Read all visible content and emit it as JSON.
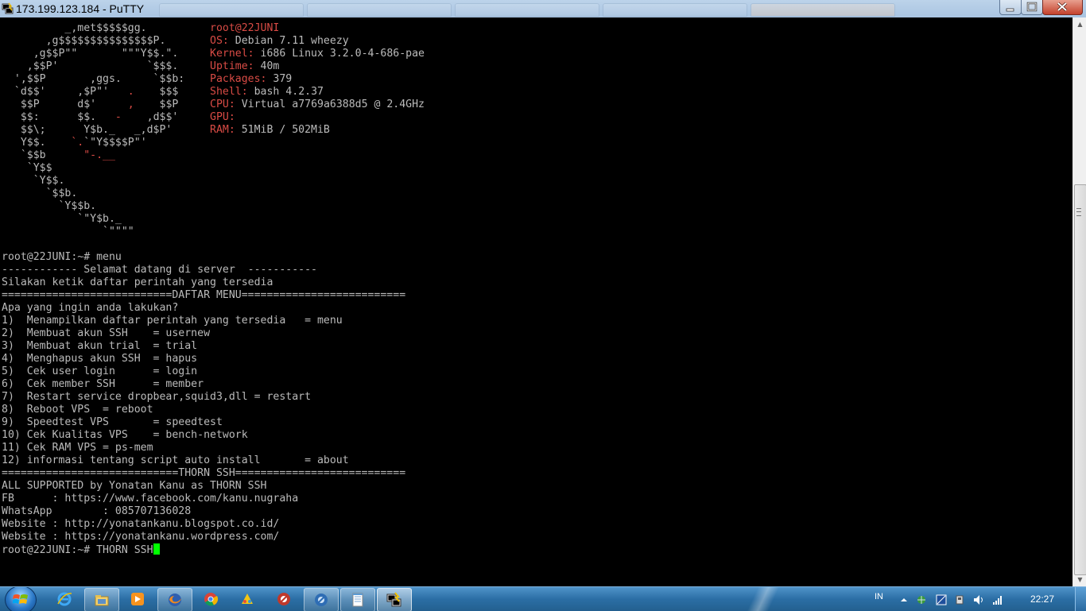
{
  "window": {
    "title": "173.199.123.184 - PuTTY"
  },
  "terminal": {
    "lines": [
      {
        "segments": [
          {
            "text": "          _,met$$$$$gg.          ",
            "red": false
          },
          {
            "text": "root@22JUNI",
            "red": true
          }
        ]
      },
      {
        "segments": [
          {
            "text": "       ,g$$$$$$$$$$$$$$$P.       ",
            "red": false
          },
          {
            "text": "OS:",
            "red": true
          },
          {
            "text": " Debian 7.11 wheezy",
            "red": false
          }
        ]
      },
      {
        "segments": [
          {
            "text": "     ,g$$P\"\"       \"\"\"Y$$.\".     ",
            "red": false
          },
          {
            "text": "Kernel:",
            "red": true
          },
          {
            "text": " i686 Linux 3.2.0-4-686-pae",
            "red": false
          }
        ]
      },
      {
        "segments": [
          {
            "text": "    ,$$P'              `$$$.     ",
            "red": false
          },
          {
            "text": "Uptime:",
            "red": true
          },
          {
            "text": " 40m",
            "red": false
          }
        ]
      },
      {
        "segments": [
          {
            "text": "  ',$$P       ,ggs.     `$$b:    ",
            "red": false
          },
          {
            "text": "Packages:",
            "red": true
          },
          {
            "text": " 379",
            "red": false
          }
        ]
      },
      {
        "segments": [
          {
            "text": "  `d$$'     ,$P\"'   ",
            "red": false
          },
          {
            "text": ".",
            "red": true
          },
          {
            "text": "    $$$     ",
            "red": false
          },
          {
            "text": "Shell:",
            "red": true
          },
          {
            "text": " bash 4.2.37",
            "red": false
          }
        ]
      },
      {
        "segments": [
          {
            "text": "   $$P      d$'     ",
            "red": false
          },
          {
            "text": ",",
            "red": true
          },
          {
            "text": "    $$P     ",
            "red": false
          },
          {
            "text": "CPU:",
            "red": true
          },
          {
            "text": " Virtual a7769a6388d5 @ 2.4GHz",
            "red": false
          }
        ]
      },
      {
        "segments": [
          {
            "text": "   $$:      $$.   ",
            "red": false
          },
          {
            "text": "-",
            "red": true
          },
          {
            "text": "    ,d$$'     ",
            "red": false
          },
          {
            "text": "GPU:",
            "red": true
          }
        ]
      },
      {
        "segments": [
          {
            "text": "   $$\\;      Y$b._   _,d$P'      ",
            "red": false
          },
          {
            "text": "RAM:",
            "red": true
          },
          {
            "text": " 51MiB / 502MiB",
            "red": false
          }
        ]
      },
      {
        "segments": [
          {
            "text": "   Y$$.    ",
            "red": false
          },
          {
            "text": "`.",
            "red": true
          },
          {
            "text": "`\"Y$$$$P\"'",
            "red": false
          }
        ]
      },
      {
        "segments": [
          {
            "text": "   `$$b      ",
            "red": false
          },
          {
            "text": "\"-.__",
            "red": true
          }
        ]
      },
      {
        "segments": [
          {
            "text": "    `Y$$",
            "red": false
          }
        ]
      },
      {
        "segments": [
          {
            "text": "     `Y$$.",
            "red": false
          }
        ]
      },
      {
        "segments": [
          {
            "text": "       `$$b.",
            "red": false
          }
        ]
      },
      {
        "segments": [
          {
            "text": "         `Y$$b.",
            "red": false
          }
        ]
      },
      {
        "segments": [
          {
            "text": "            `\"Y$b._",
            "red": false
          }
        ]
      },
      {
        "segments": [
          {
            "text": "                `\"\"\"\"",
            "red": false
          }
        ]
      },
      {
        "segments": [
          {
            "text": "",
            "red": false
          }
        ]
      },
      {
        "segments": [
          {
            "text": "root@22JUNI:~# menu",
            "red": false
          }
        ]
      },
      {
        "segments": [
          {
            "text": "------------ Selamat datang di server  -----------",
            "red": false
          }
        ]
      },
      {
        "segments": [
          {
            "text": "Silakan ketik daftar perintah yang tersedia",
            "red": false
          }
        ]
      },
      {
        "segments": [
          {
            "text": "===========================DAFTAR MENU==========================",
            "red": false
          }
        ]
      },
      {
        "segments": [
          {
            "text": "Apa yang ingin anda lakukan?",
            "red": false
          }
        ]
      },
      {
        "segments": [
          {
            "text": "1)  Menampilkan daftar perintah yang tersedia   = menu",
            "red": false
          }
        ]
      },
      {
        "segments": [
          {
            "text": "2)  Membuat akun SSH    = usernew",
            "red": false
          }
        ]
      },
      {
        "segments": [
          {
            "text": "3)  Membuat akun trial  = trial",
            "red": false
          }
        ]
      },
      {
        "segments": [
          {
            "text": "4)  Menghapus akun SSH  = hapus",
            "red": false
          }
        ]
      },
      {
        "segments": [
          {
            "text": "5)  Cek user login      = login",
            "red": false
          }
        ]
      },
      {
        "segments": [
          {
            "text": "6)  Cek member SSH      = member",
            "red": false
          }
        ]
      },
      {
        "segments": [
          {
            "text": "7)  Restart service dropbear,squid3,dll = restart",
            "red": false
          }
        ]
      },
      {
        "segments": [
          {
            "text": "8)  Reboot VPS  = reboot",
            "red": false
          }
        ]
      },
      {
        "segments": [
          {
            "text": "9)  Speedtest VPS       = speedtest",
            "red": false
          }
        ]
      },
      {
        "segments": [
          {
            "text": "10) Cek Kualitas VPS    = bench-network",
            "red": false
          }
        ]
      },
      {
        "segments": [
          {
            "text": "11) Cek RAM VPS = ps-mem",
            "red": false
          }
        ]
      },
      {
        "segments": [
          {
            "text": "12) informasi tentang script auto install       = about",
            "red": false
          }
        ]
      },
      {
        "segments": [
          {
            "text": "============================THORN SSH===========================",
            "red": false
          }
        ]
      },
      {
        "segments": [
          {
            "text": "ALL SUPPORTED by Yonatan Kanu as THORN SSH",
            "red": false
          }
        ]
      },
      {
        "segments": [
          {
            "text": "FB      : https://www.facebook.com/kanu.nugraha",
            "red": false
          }
        ]
      },
      {
        "segments": [
          {
            "text": "WhatsApp        : 085707136028",
            "red": false
          }
        ]
      },
      {
        "segments": [
          {
            "text": "Website : http://yonatankanu.blogspot.co.id/",
            "red": false
          }
        ]
      },
      {
        "segments": [
          {
            "text": "Website : https://yonatankanu.wordpress.com/",
            "red": false
          }
        ]
      },
      {
        "segments": [
          {
            "text": "root@22JUNI:~# THORN SSH",
            "red": false
          }
        ]
      }
    ],
    "colors": {
      "foreground": "#bbbbbb",
      "accent_red": "#d94b45",
      "cursor": "#00ff00",
      "background": "#000000"
    }
  },
  "taskbar": {
    "icons": [
      "windows-start-orb",
      "internet-explorer-icon",
      "file-explorer-icon",
      "media-player-icon",
      "firefox-icon",
      "chrome-icon",
      "paint-icon",
      "app-red-icon",
      "app-blue-icon",
      "notepad-icon",
      "putty-icon"
    ],
    "language": "IN",
    "clock": "22:27"
  }
}
